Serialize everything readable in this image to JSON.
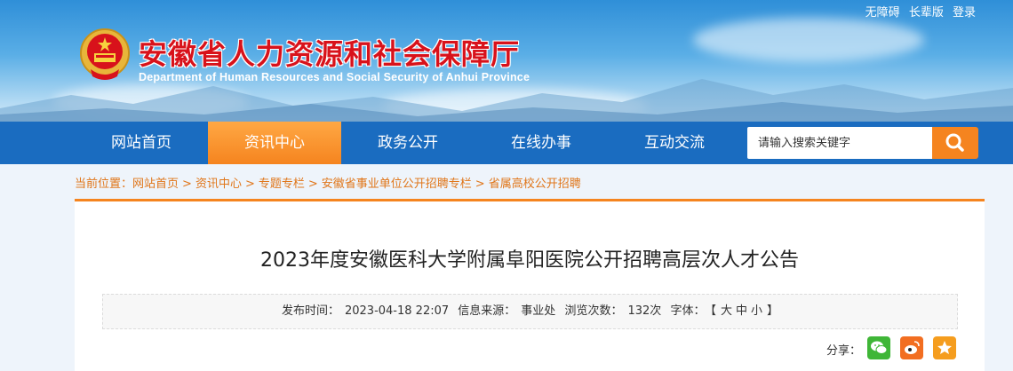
{
  "top_links": [
    "无障碍",
    "长辈版",
    "登录"
  ],
  "site": {
    "title": "安徽省人力资源和社会保障厅",
    "subtitle": "Department of Human Resources and Social Security of Anhui Province"
  },
  "nav": {
    "items": [
      {
        "label": "网站首页",
        "active": false
      },
      {
        "label": "资讯中心",
        "active": true
      },
      {
        "label": "政务公开",
        "active": false
      },
      {
        "label": "在线办事",
        "active": false
      },
      {
        "label": "互动交流",
        "active": false
      }
    ],
    "search_placeholder": "请输入搜索关键字",
    "search_icon": "search-icon"
  },
  "breadcrumb": {
    "prefix": "当前位置：",
    "items": [
      "网站首页",
      "资讯中心",
      "专题专栏",
      "安徽省事业单位公开招聘专栏",
      "省属高校公开招聘"
    ],
    "separator": ">"
  },
  "article": {
    "title": "2023年度安徽医科大学附属阜阳医院公开招聘高层次人才公告",
    "meta": {
      "publish_label": "发布时间：",
      "publish_time": "2023-04-18 22:07",
      "source_label": "信息来源：",
      "source": "事业处",
      "views_label": "浏览次数：",
      "views": "132次",
      "font_label": "字体：",
      "font_open": "【",
      "font_sizes": [
        "大",
        "中",
        "小"
      ],
      "font_close": "】"
    },
    "share_label": "分享：",
    "share_icons": [
      "wechat-icon",
      "weibo-icon",
      "qzone-icon"
    ]
  },
  "colors": {
    "nav_blue": "#1a6cc0",
    "accent_orange": "#f5841f",
    "title_red": "#d8121b",
    "crumb_orange": "#e0761a"
  }
}
